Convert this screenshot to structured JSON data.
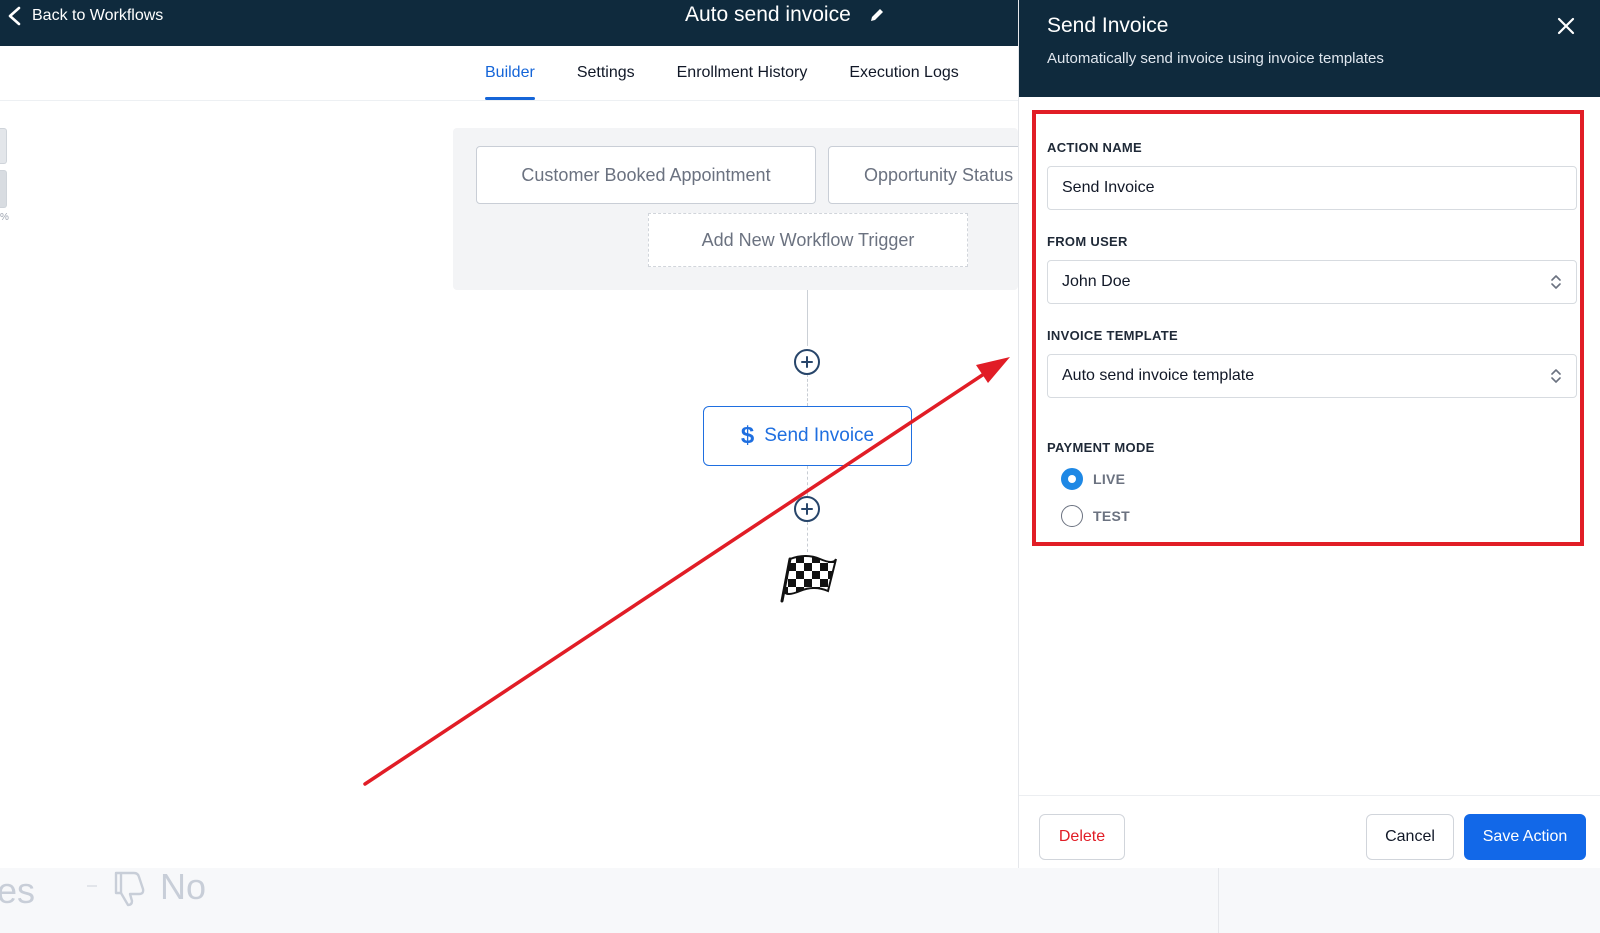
{
  "header": {
    "back_label": "Back to Workflows",
    "workflow_title": "Auto send invoice"
  },
  "tabs": [
    {
      "label": "Builder",
      "active": true
    },
    {
      "label": "Settings",
      "active": false
    },
    {
      "label": "Enrollment History",
      "active": false
    },
    {
      "label": "Execution Logs",
      "active": false
    }
  ],
  "left_fragment": {
    "percent_text": "%"
  },
  "triggers": {
    "items": [
      {
        "label": "Customer Booked Appointment"
      },
      {
        "label": "Opportunity Status"
      }
    ],
    "add_label": "Add New Workflow Trigger"
  },
  "flow": {
    "action_node": {
      "label": "Send Invoice",
      "icon": "dollar-icon",
      "symbol": "$"
    },
    "end_icon": "checkered-flag-icon"
  },
  "feedback": {
    "yes_fragment": "es",
    "no_label": "No"
  },
  "drawer": {
    "title": "Send Invoice",
    "subtitle": "Automatically send invoice using invoice templates",
    "fields": {
      "action_name": {
        "label": "ACTION NAME",
        "value": "Send Invoice"
      },
      "from_user": {
        "label": "FROM USER",
        "value": "John Doe"
      },
      "invoice_template": {
        "label": "INVOICE TEMPLATE",
        "value": "Auto send invoice template"
      },
      "payment_mode": {
        "label": "PAYMENT MODE",
        "options": [
          {
            "label": "LIVE",
            "selected": true
          },
          {
            "label": "TEST",
            "selected": false
          }
        ]
      }
    },
    "buttons": {
      "delete": "Delete",
      "cancel": "Cancel",
      "save": "Save Action"
    }
  },
  "colors": {
    "header_bg": "#0f2a3d",
    "accent_blue": "#1565d8",
    "annotation_red": "#e11d26"
  }
}
